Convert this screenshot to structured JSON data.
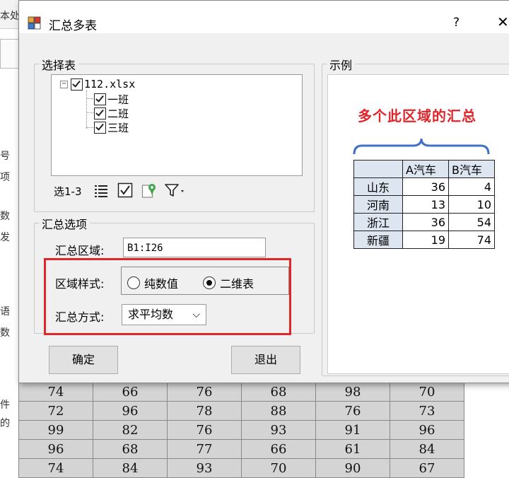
{
  "background": {
    "toolbar_fragment": "本处",
    "left_strip_glyphs": [
      "号",
      "项",
      "数",
      "发",
      "语",
      "数",
      "件",
      "的"
    ],
    "grid_rows": [
      [
        "74",
        "66",
        "76",
        "68",
        "98",
        "70"
      ],
      [
        "72",
        "96",
        "78",
        "88",
        "76",
        "73"
      ],
      [
        "99",
        "82",
        "76",
        "93",
        "91",
        "96"
      ],
      [
        "96",
        "68",
        "77",
        "66",
        "61",
        "84"
      ],
      [
        "74",
        "84",
        "93",
        "70",
        "90",
        "67"
      ]
    ]
  },
  "dialog": {
    "title": "汇总多表",
    "help": "?",
    "close": "✕",
    "select_tables": {
      "legend": "选择表",
      "root": "112.xlsx",
      "children": [
        "一班",
        "二班",
        "三班"
      ],
      "toolbar_label": "选1-3"
    },
    "options": {
      "legend": "汇总选项",
      "range_label": "汇总区域:",
      "range_value": "B1:I26",
      "style_label": "区域样式:",
      "style_options": [
        "纯数值",
        "二维表"
      ],
      "style_selected": "二维表",
      "method_label": "汇总方式:",
      "method_value": "求平均数"
    },
    "ok_button": "确定",
    "exit_button": "退出",
    "example": {
      "legend": "示例",
      "caption": "多个此区域的汇总",
      "columns": [
        "A汽车",
        "B汽车"
      ],
      "rows": [
        {
          "name": "山东",
          "a": "36",
          "b": "4"
        },
        {
          "name": "河南",
          "a": "13",
          "b": "10"
        },
        {
          "name": "浙江",
          "a": "36",
          "b": "54"
        },
        {
          "name": "新疆",
          "a": "19",
          "b": "74"
        }
      ]
    },
    "colors": {
      "highlight": "#e0262a",
      "example_header": "#dde6f0",
      "bracket": "#3f72c4"
    }
  }
}
